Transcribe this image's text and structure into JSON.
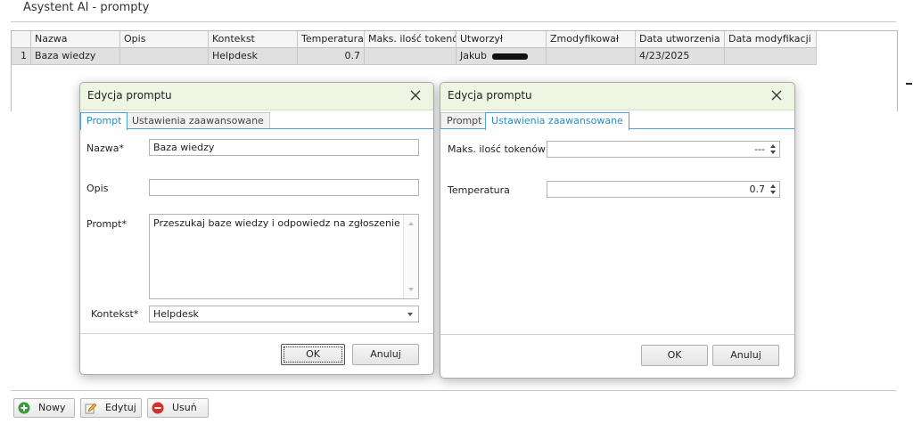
{
  "page": {
    "title": "Asystent AI - prompty"
  },
  "grid": {
    "columns": [
      "Nazwa",
      "Opis",
      "Kontekst",
      "Temperatura",
      "Maks. ilość tokenów",
      "Utworzył",
      "Zmodyfikował",
      "Data utworzenia",
      "Data modyfikacji"
    ],
    "rows": [
      {
        "index": "1",
        "nazwa": "Baza wiedzy",
        "opis": "",
        "kontekst": "Helpdesk",
        "temperatura": "0.7",
        "maks_tokenow": "",
        "utworzyl": "Jakub",
        "zmodyfikowal": "",
        "data_utworzenia": "4/23/2025",
        "data_modyfikacji": ""
      }
    ]
  },
  "dialog_prompt": {
    "title": "Edycja promptu",
    "tabs": [
      "Prompt",
      "Ustawienia zaawansowane"
    ],
    "active_tab": "Prompt",
    "labels": {
      "nazwa": "Nazwa*",
      "opis": "Opis",
      "prompt": "Prompt*",
      "kontekst": "Kontekst*"
    },
    "values": {
      "nazwa": "Baza wiedzy",
      "opis": "",
      "prompt": "Przeszukaj baze wiedzy i odpowiedz na zgłoszenie",
      "kontekst": "Helpdesk"
    },
    "ok": "OK",
    "cancel": "Anuluj"
  },
  "dialog_advanced": {
    "title": "Edycja promptu",
    "tabs": [
      "Prompt",
      "Ustawienia zaawansowane"
    ],
    "active_tab": "Ustawienia zaawansowane",
    "labels": {
      "maks_tokenow": "Maks. ilość tokenów",
      "temperatura": "Temperatura"
    },
    "values": {
      "maks_tokenow": "---",
      "temperatura": "0.7"
    },
    "ok": "OK",
    "cancel": "Anuluj"
  },
  "toolbar": {
    "new_label": "Nowy",
    "edit_label": "Edytuj",
    "delete_label": "Usuń",
    "new_icon": "plus-circle-icon",
    "edit_icon": "pencil-icon",
    "delete_icon": "minus-circle-icon"
  },
  "colors": {
    "accent": "#1e8fd0",
    "title_bar": "#eef5e3",
    "row_selected": "#e0e0e0",
    "add_green": "#3a9b3a",
    "delete_red": "#d0312d"
  }
}
